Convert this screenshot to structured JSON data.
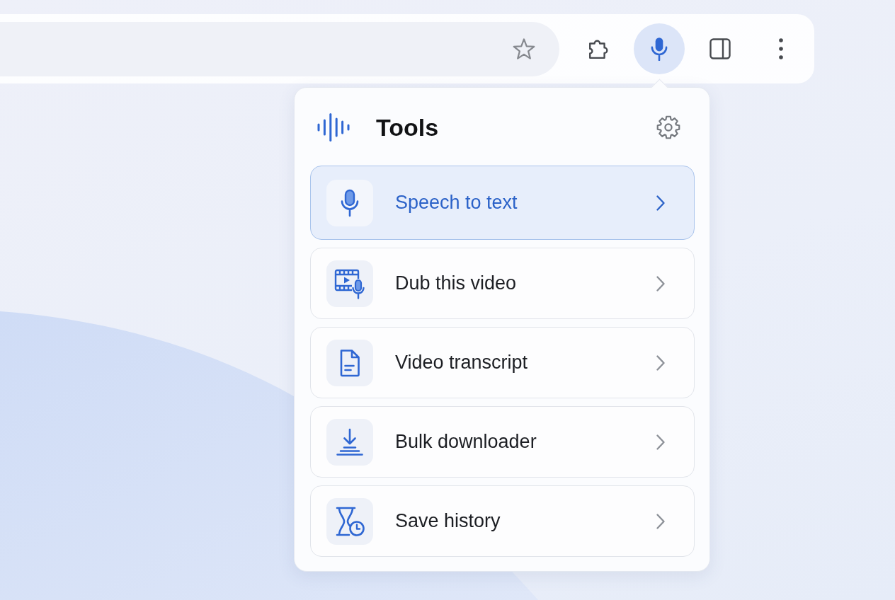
{
  "address_bar": {
    "bookmarked": false
  },
  "toolbar_buttons": [
    {
      "kind": "extensions",
      "selected": false
    },
    {
      "kind": "microphone",
      "selected": true
    },
    {
      "kind": "side_panel",
      "selected": false
    },
    {
      "kind": "menu",
      "selected": false
    }
  ],
  "popup": {
    "title": "Tools",
    "items": [
      {
        "kind": "speech",
        "label": "Speech to text",
        "selected": true
      },
      {
        "kind": "dub",
        "label": "Dub this video",
        "selected": false
      },
      {
        "kind": "transcript",
        "label": "Video transcript",
        "selected": false
      },
      {
        "kind": "download",
        "label": "Bulk downloader",
        "selected": false
      },
      {
        "kind": "history",
        "label": "Save history",
        "selected": false
      }
    ]
  }
}
